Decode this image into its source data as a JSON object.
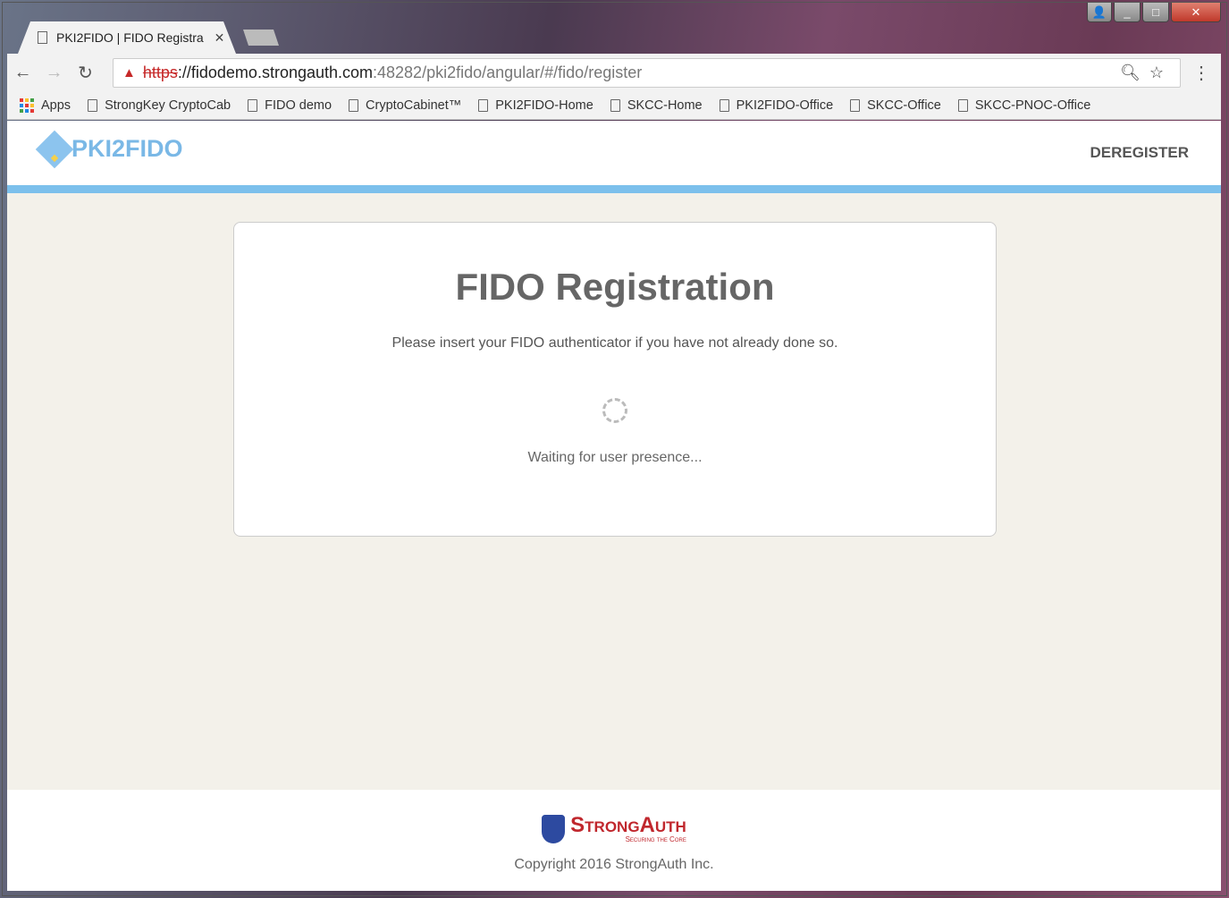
{
  "browser": {
    "tab_title": "PKI2FIDO | FIDO Registra",
    "url": {
      "scheme": "https",
      "host": "://fidodemo.strongauth.com",
      "path": ":48282/pki2fido/angular/#/fido/register"
    },
    "bookmarks": [
      "Apps",
      "StrongKey CryptoCab",
      "FIDO demo",
      "CryptoCabinet™",
      "PKI2FIDO-Home",
      "SKCC-Home",
      "PKI2FIDO-Office",
      "SKCC-Office",
      "SKCC-PNOC-Office"
    ]
  },
  "header": {
    "logo_text": "PKI2FIDO",
    "deregister_label": "DEREGISTER"
  },
  "card": {
    "title": "FIDO Registration",
    "instruction": "Please insert your FIDO authenticator if you have not already done so.",
    "status": "Waiting for user presence..."
  },
  "footer": {
    "logo_text": "StrongAuth",
    "logo_tagline": "Securing the Core",
    "copyright": "Copyright 2016 StrongAuth Inc."
  },
  "colors": {
    "accent": "#7cc0ec",
    "brand_red": "#c0272d"
  }
}
